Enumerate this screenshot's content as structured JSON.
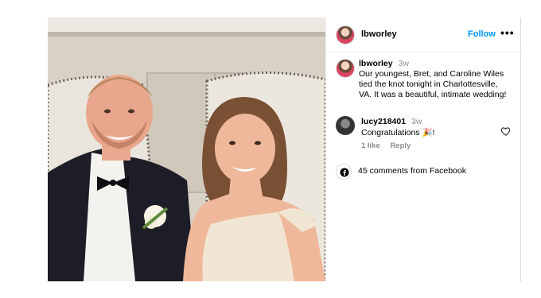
{
  "post": {
    "author": "lbworley",
    "follow_label": "Follow",
    "more_label": "•••",
    "caption": {
      "username": "lbworley",
      "time": "3w",
      "text_lines": [
        "Our youngest, Bret, and Caroline Wiles",
        "tied the knot tonight in Charlottesville,",
        "VA. It was a beautiful, intimate wedding!"
      ]
    },
    "comment": {
      "username": "lucy218401",
      "time": "3w",
      "text": "Congratulations 🎉!",
      "likes_label": "1 like",
      "reply_label": "Reply"
    },
    "facebook_comments": "45 comments from Facebook"
  },
  "colors": {
    "accent_blue": "#0095f6",
    "muted_gray": "#8e8e8e",
    "border": "#efefef"
  },
  "icons": [
    "heart-icon",
    "facebook-icon",
    "more-icon"
  ]
}
